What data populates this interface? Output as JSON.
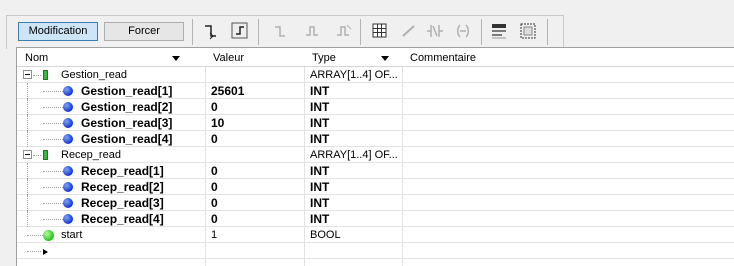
{
  "toolbar": {
    "modification_label": "Modification",
    "forcer_label": "Forcer",
    "icons": [
      "force-value-icon",
      "force-edge-icon",
      "rising-edge-icon",
      "falling-edge-icon",
      "unforce-icon",
      "table-icon",
      "force-mode-icon",
      "contact-icon",
      "coil-icon",
      "display-format-icon",
      "select-icon"
    ]
  },
  "table": {
    "columns": {
      "nom": "Nom",
      "valeur": "Valeur",
      "type": "Type",
      "commentaire": "Commentaire"
    },
    "rows": [
      {
        "kind": "group",
        "name": "Gestion_read",
        "value": "",
        "type": "ARRAY[1..4] OF...",
        "comment": ""
      },
      {
        "kind": "child",
        "name": "Gestion_read[1]",
        "value": "25601",
        "type": "INT",
        "comment": ""
      },
      {
        "kind": "child",
        "name": "Gestion_read[2]",
        "value": "0",
        "type": "INT",
        "comment": ""
      },
      {
        "kind": "child",
        "name": "Gestion_read[3]",
        "value": "10",
        "type": "INT",
        "comment": ""
      },
      {
        "kind": "child",
        "name": "Gestion_read[4]",
        "value": "0",
        "type": "INT",
        "comment": ""
      },
      {
        "kind": "group",
        "name": "Recep_read",
        "value": "",
        "type": "ARRAY[1..4] OF...",
        "comment": ""
      },
      {
        "kind": "child",
        "name": "Recep_read[1]",
        "value": "0",
        "type": "INT",
        "comment": ""
      },
      {
        "kind": "child",
        "name": "Recep_read[2]",
        "value": "0",
        "type": "INT",
        "comment": ""
      },
      {
        "kind": "child",
        "name": "Recep_read[3]",
        "value": "0",
        "type": "INT",
        "comment": ""
      },
      {
        "kind": "child",
        "name": "Recep_read[4]",
        "value": "0",
        "type": "INT",
        "comment": ""
      },
      {
        "kind": "bool",
        "name": "start",
        "value": "1",
        "type": "BOOL",
        "comment": ""
      },
      {
        "kind": "new",
        "name": "",
        "value": "",
        "type": "",
        "comment": ""
      }
    ]
  }
}
